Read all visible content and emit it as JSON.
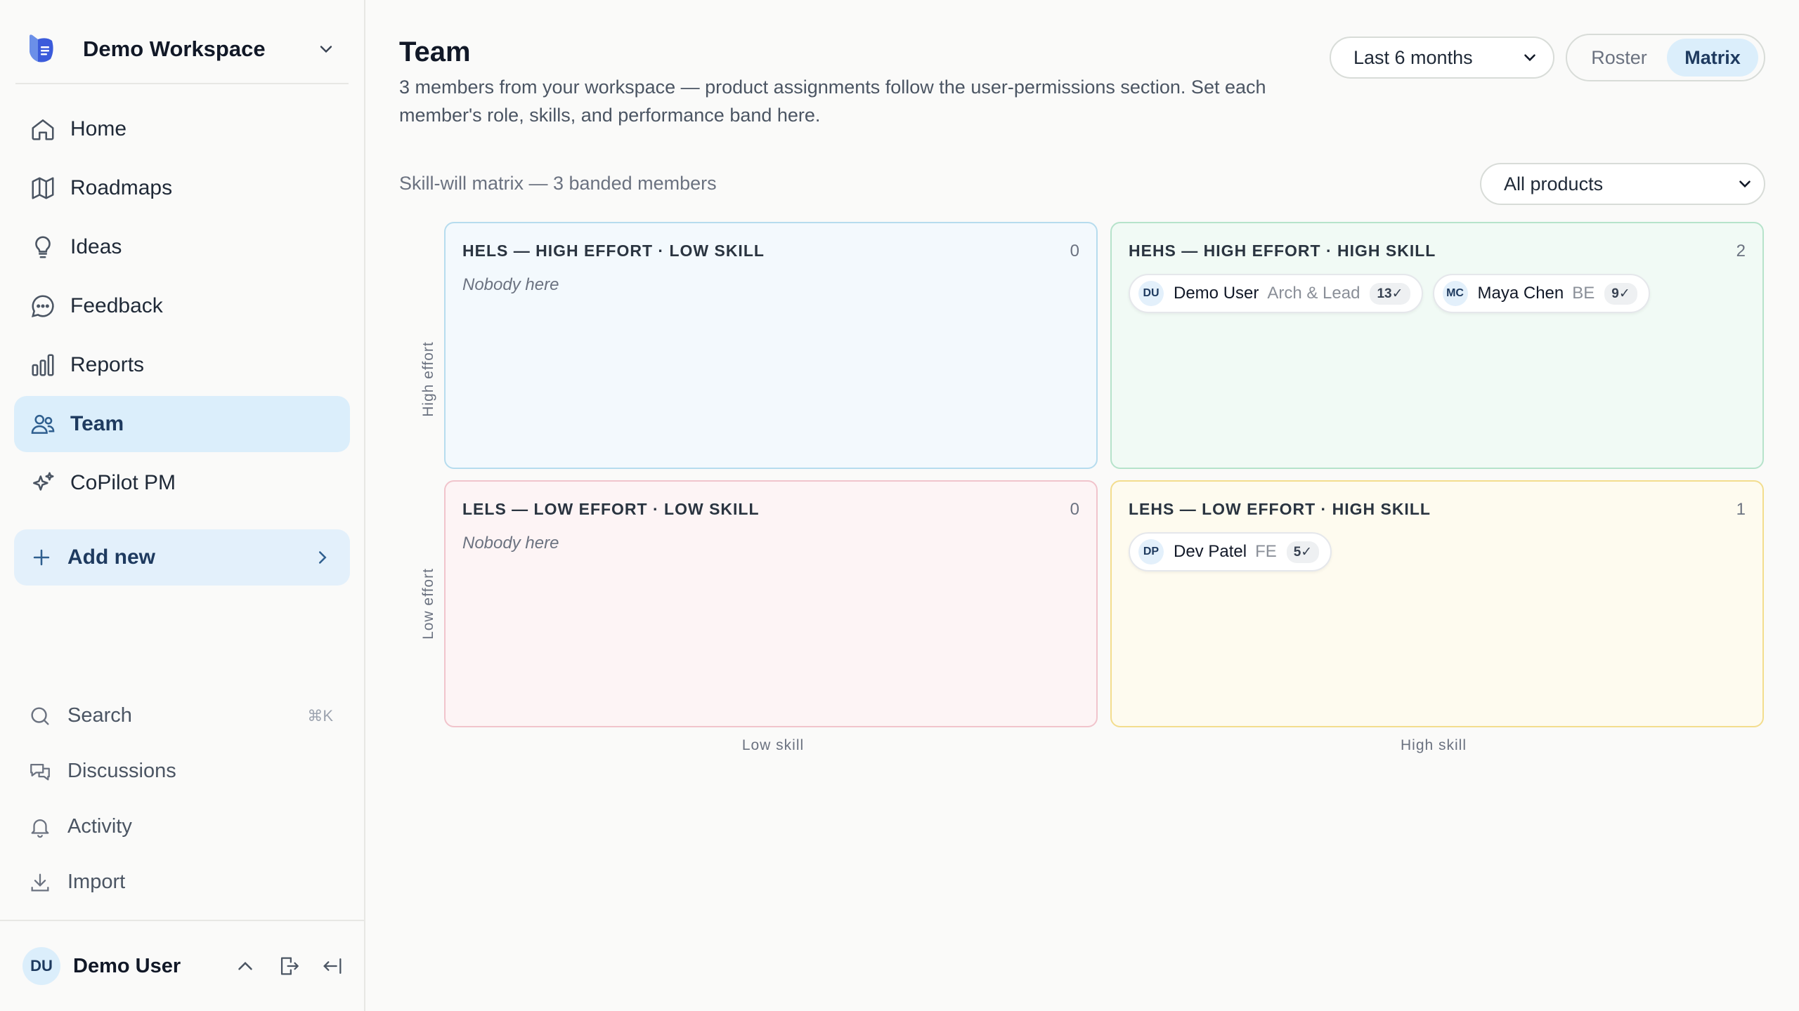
{
  "workspace": {
    "name": "Demo Workspace"
  },
  "nav": [
    {
      "label": "Home",
      "icon": "home-icon"
    },
    {
      "label": "Roadmaps",
      "icon": "map-icon"
    },
    {
      "label": "Ideas",
      "icon": "lightbulb-icon"
    },
    {
      "label": "Feedback",
      "icon": "chat-icon"
    },
    {
      "label": "Reports",
      "icon": "bar-chart-icon"
    },
    {
      "label": "Team",
      "icon": "users-icon",
      "active": true
    },
    {
      "label": "CoPilot PM",
      "icon": "sparkles-icon"
    }
  ],
  "add_new": {
    "label": "Add new"
  },
  "bottom_nav": {
    "search": {
      "label": "Search",
      "shortcut": "⌘K"
    },
    "discussions": {
      "label": "Discussions"
    },
    "activity": {
      "label": "Activity"
    },
    "import": {
      "label": "Import"
    }
  },
  "user": {
    "initials": "DU",
    "name": "Demo User"
  },
  "header": {
    "title": "Team",
    "description": "3 members from your workspace — product assignments follow the user-permissions section. Set each member's role, skills, and performance band here.",
    "range": "Last 6 months",
    "views": {
      "roster": "Roster",
      "matrix": "Matrix",
      "selected": "Matrix"
    }
  },
  "matrix": {
    "caption": "Skill-will matrix — 3 banded members",
    "product_filter": "All products",
    "axes": {
      "high_effort": "High effort",
      "low_effort": "Low effort",
      "low_skill": "Low skill",
      "high_skill": "High skill"
    },
    "empty_text": "Nobody here",
    "quadrants": {
      "hels": {
        "title": "HELS — HIGH EFFORT · LOW SKILL",
        "count": "0",
        "members": []
      },
      "hehs": {
        "title": "HEHS — HIGH EFFORT · HIGH SKILL",
        "count": "2",
        "members": [
          {
            "initials": "DU",
            "name": "Demo User",
            "role": "Arch & Lead",
            "done": "13✓"
          },
          {
            "initials": "MC",
            "name": "Maya Chen",
            "role": "BE",
            "done": "9✓"
          }
        ]
      },
      "lels": {
        "title": "LELS — LOW EFFORT · LOW SKILL",
        "count": "0",
        "members": []
      },
      "lehs": {
        "title": "LEHS — LOW EFFORT · HIGH SKILL",
        "count": "1",
        "members": [
          {
            "initials": "DP",
            "name": "Dev Patel",
            "role": "FE",
            "done": "5✓"
          }
        ]
      }
    }
  },
  "colors": {
    "accent": "#dbeefb",
    "accent_text": "#1e3a5f",
    "hels_bg": "#f3f9fd",
    "hehs_bg": "#f1faf5",
    "lels_bg": "#fdf4f5",
    "lehs_bg": "#fefbef"
  }
}
